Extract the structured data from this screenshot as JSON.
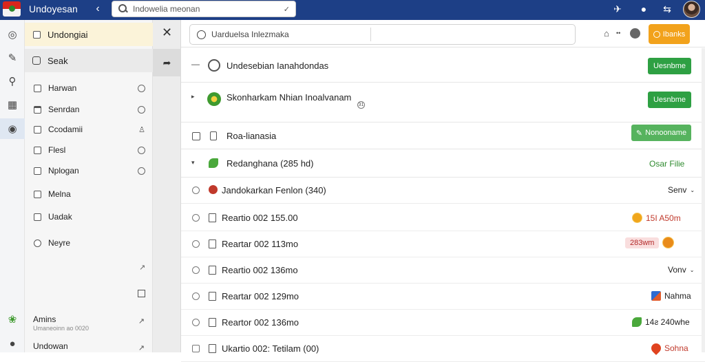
{
  "header": {
    "app_title": "Undoyesan",
    "search_placeholder": "Indowelia meonan",
    "search_mic": "✓"
  },
  "folders": {
    "head_label": "Undongiai",
    "selected_label": "Seak",
    "items": [
      {
        "label": "Harwan",
        "marker": "radio"
      },
      {
        "label": "Senrdan",
        "marker": "radio"
      },
      {
        "label": "Ccodamii",
        "marker": "lock"
      },
      {
        "label": "Flesl",
        "marker": "radio"
      },
      {
        "label": "Nplogan",
        "marker": "radio"
      },
      {
        "label": "Melna",
        "marker": "none"
      },
      {
        "label": "Uadak",
        "marker": "none"
      },
      {
        "label": "Neyre",
        "marker": "none"
      }
    ],
    "footer": {
      "account_name": "Amins",
      "account_sub": "Umaneoinn ao 0020",
      "bottom_label": "Undowan"
    }
  },
  "main": {
    "search_text": "Uarduelsa Inlezmaka",
    "action_button": "Ibanks",
    "rows": [
      {
        "title": "Undesebian Ianahdondas",
        "button": "Uesnbme"
      },
      {
        "title": "Skonharkam Nhian Inoalvanam",
        "button": "Uesnbme",
        "note": "31"
      },
      {
        "title": "Roa-lianasia",
        "button": "Nonooname"
      }
    ],
    "group": {
      "label": "Redanghana (285 hd)",
      "right": "Osar Filie"
    },
    "mails": [
      {
        "text": "Jandokarkan Fenlon (340)",
        "right": "Senv",
        "style": "plain"
      },
      {
        "text": "Reartio 002  155.00",
        "right": "15I A50m",
        "style": "orange"
      },
      {
        "text": "Reartar 002  113mo",
        "right": "283wm",
        "style": "pill"
      },
      {
        "text": "Reartio 002  136mo",
        "right": "Vonv",
        "style": "plain"
      },
      {
        "text": "Reartar 002  129mo",
        "right": "Nahma",
        "style": "blue"
      },
      {
        "text": "Reartor 002  136mo",
        "right": "14ƨ 240whe",
        "style": "green"
      },
      {
        "text": "Ukartio 002: Tetilam (00)",
        "right": "Sohna",
        "style": "flame"
      }
    ]
  },
  "colors": {
    "topbar": "#1d3f86",
    "accent_orange": "#f2a21c",
    "accent_green": "#2ea043",
    "group_green": "#2e8a2e"
  }
}
